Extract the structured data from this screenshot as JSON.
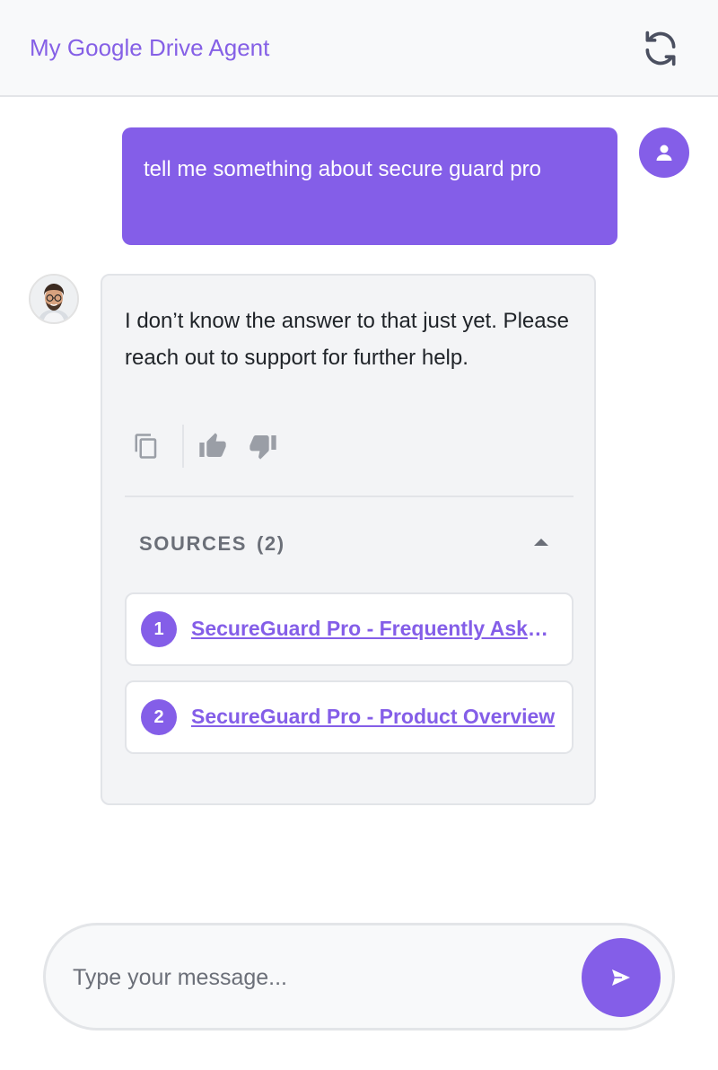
{
  "header": {
    "title": "My Google Drive Agent",
    "refresh_icon": "refresh-icon"
  },
  "colors": {
    "accent": "#845ee8",
    "header_bg": "#f8f9fa",
    "card_bg": "#f3f4f6",
    "muted": "#6b6f78"
  },
  "messages": {
    "user": {
      "text": "tell me something about secure guard pro",
      "avatar_icon": "person-icon"
    },
    "bot": {
      "text": "I don’t know the answer to that just yet. Please reach out to support for further help.",
      "avatar": "agent-avatar-photo",
      "actions": {
        "copy_icon": "copy-icon",
        "thumbs_up_icon": "thumbs-up-icon",
        "thumbs_down_icon": "thumbs-down-icon"
      },
      "sources": {
        "label": "SOURCES",
        "count": "(2)",
        "expanded": true,
        "items": [
          {
            "number": "1",
            "title": "SecureGuard Pro - Frequently Asked Questions"
          },
          {
            "number": "2",
            "title": "SecureGuard Pro - Product Overview"
          }
        ]
      }
    }
  },
  "composer": {
    "placeholder": "Type your message...",
    "value": "",
    "send_icon": "send-icon"
  }
}
